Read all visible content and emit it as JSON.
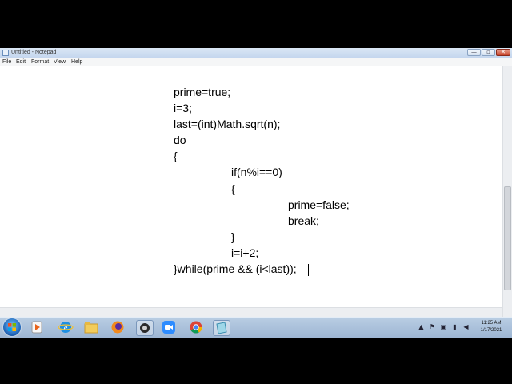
{
  "window": {
    "title": "Untitled - Notepad",
    "controls": {
      "minimize": "—",
      "maximize": "▫",
      "close": "✕"
    }
  },
  "menubar": {
    "items": [
      "File",
      "Edit",
      "Format",
      "View",
      "Help"
    ]
  },
  "editor": {
    "lines": [
      {
        "text": "prime=true;",
        "indent": 0
      },
      {
        "text": "i=3;",
        "indent": 0
      },
      {
        "text": "last=(int)Math.sqrt(n);",
        "indent": 0
      },
      {
        "text": "do",
        "indent": 0
      },
      {
        "text": "{",
        "indent": 0
      },
      {
        "text": "if(n%i==0)",
        "indent": 1
      },
      {
        "text": "{",
        "indent": 1
      },
      {
        "text": "prime=false;",
        "indent": 2
      },
      {
        "text": "break;",
        "indent": 2
      },
      {
        "text": "}",
        "indent": 1
      },
      {
        "text": "i=i+2;",
        "indent": 1
      },
      {
        "text": "}while(prime && (i<last));",
        "indent": 0
      }
    ]
  },
  "taskbar": {
    "apps": [
      "internet-explorer",
      "file-explorer",
      "firefox",
      "media-player",
      "zoom",
      "chrome",
      "notepad"
    ],
    "tray": [
      "show-hidden-arrow",
      "flag",
      "network",
      "volume"
    ],
    "clock": {
      "time": "11:25 AM",
      "date": "1/17/2021"
    }
  }
}
